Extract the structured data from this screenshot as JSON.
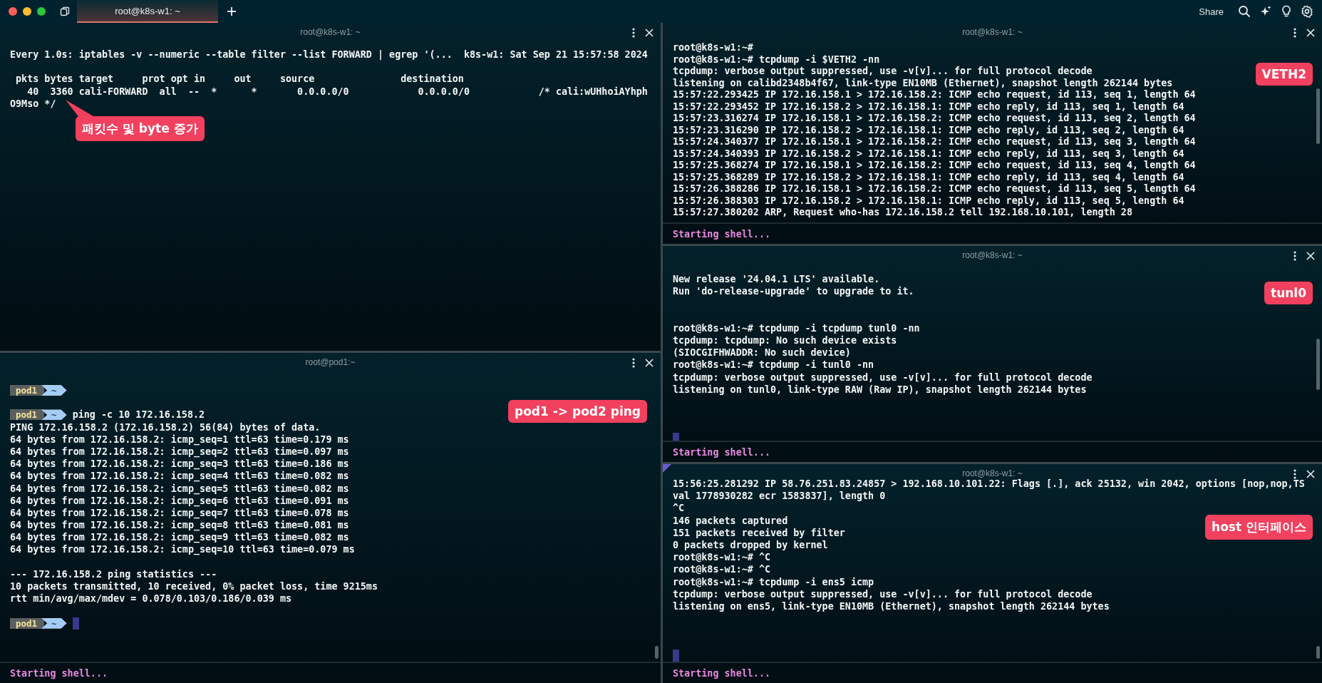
{
  "tab_bar": {
    "tabs": [
      {
        "label": "root@k8s-w1: ~",
        "selected": true
      }
    ],
    "share": "Share"
  },
  "left_column": {
    "panes": [
      {
        "title": "root@k8s-w1: ~",
        "annotation": {
          "text": "패킷수 및 byte 증가",
          "pointer": true
        },
        "lines": [
          {
            "kind": "text",
            "text": "Every 1.0s: iptables -v --numeric --table filter --list FORWARD | egrep '(...  k8s-w1: Sat Sep 21 15:57:58 2024"
          },
          {
            "kind": "blank"
          },
          {
            "kind": "text",
            "text": " pkts bytes target     prot opt in     out     source               destination"
          },
          {
            "kind": "text",
            "text": "   40  3360 cali-FORWARD  all  --  *      *       0.0.0.0/0            0.0.0.0/0            /* cali:wUHhoiAYhph"
          },
          {
            "kind": "text",
            "text": "O9Mso */"
          }
        ]
      },
      {
        "title": "root@pod1:~",
        "annotation": {
          "text": "pod1 -> pod2 ping",
          "pointer": false
        },
        "status": "Starting shell...",
        "lines": [
          {
            "kind": "prompt",
            "segments": [
              "pod1",
              "~"
            ],
            "cursor": false
          },
          {
            "kind": "blank"
          },
          {
            "kind": "prompt",
            "segments": [
              "pod1",
              "~"
            ],
            "command": "ping -c 10 172.16.158.2",
            "cursor": false
          },
          {
            "kind": "text",
            "text": "PING 172.16.158.2 (172.16.158.2) 56(84) bytes of data."
          },
          {
            "kind": "text",
            "text": "64 bytes from 172.16.158.2: icmp_seq=1 ttl=63 time=0.179 ms"
          },
          {
            "kind": "text",
            "text": "64 bytes from 172.16.158.2: icmp_seq=2 ttl=63 time=0.097 ms"
          },
          {
            "kind": "text",
            "text": "64 bytes from 172.16.158.2: icmp_seq=3 ttl=63 time=0.186 ms"
          },
          {
            "kind": "text",
            "text": "64 bytes from 172.16.158.2: icmp_seq=4 ttl=63 time=0.082 ms"
          },
          {
            "kind": "text",
            "text": "64 bytes from 172.16.158.2: icmp_seq=5 ttl=63 time=0.082 ms"
          },
          {
            "kind": "text",
            "text": "64 bytes from 172.16.158.2: icmp_seq=6 ttl=63 time=0.091 ms"
          },
          {
            "kind": "text",
            "text": "64 bytes from 172.16.158.2: icmp_seq=7 ttl=63 time=0.078 ms"
          },
          {
            "kind": "text",
            "text": "64 bytes from 172.16.158.2: icmp_seq=8 ttl=63 time=0.081 ms"
          },
          {
            "kind": "text",
            "text": "64 bytes from 172.16.158.2: icmp_seq=9 ttl=63 time=0.082 ms"
          },
          {
            "kind": "text",
            "text": "64 bytes from 172.16.158.2: icmp_seq=10 ttl=63 time=0.079 ms"
          },
          {
            "kind": "blank"
          },
          {
            "kind": "text",
            "text": "--- 172.16.158.2 ping statistics ---"
          },
          {
            "kind": "text",
            "text": "10 packets transmitted, 10 received, 0% packet loss, time 9215ms"
          },
          {
            "kind": "text",
            "text": "rtt min/avg/max/mdev = 0.078/0.103/0.186/0.039 ms"
          },
          {
            "kind": "blank"
          },
          {
            "kind": "prompt",
            "segments": [
              "pod1",
              "~"
            ],
            "cursor": true
          }
        ]
      }
    ]
  },
  "right_column": {
    "panes": [
      {
        "title": "root@k8s-w1: ~",
        "annotation": {
          "text": "VETH2",
          "pointer": false
        },
        "status": "Starting shell...",
        "lines": [
          {
            "kind": "text",
            "text": "root@k8s-w1:~#"
          },
          {
            "kind": "text",
            "text": "root@k8s-w1:~# tcpdump -i $VETH2 -nn"
          },
          {
            "kind": "text",
            "text": "tcpdump: verbose output suppressed, use -v[v]... for full protocol decode"
          },
          {
            "kind": "text",
            "text": "listening on calibd2348b4f67, link-type EN10MB (Ethernet), snapshot length 262144 bytes"
          },
          {
            "kind": "text",
            "text": "15:57:22.293425 IP 172.16.158.1 > 172.16.158.2: ICMP echo request, id 113, seq 1, length 64"
          },
          {
            "kind": "text",
            "text": "15:57:22.293452 IP 172.16.158.2 > 172.16.158.1: ICMP echo reply, id 113, seq 1, length 64"
          },
          {
            "kind": "text",
            "text": "15:57:23.316274 IP 172.16.158.1 > 172.16.158.2: ICMP echo request, id 113, seq 2, length 64"
          },
          {
            "kind": "text",
            "text": "15:57:23.316290 IP 172.16.158.2 > 172.16.158.1: ICMP echo reply, id 113, seq 2, length 64"
          },
          {
            "kind": "text",
            "text": "15:57:24.340377 IP 172.16.158.1 > 172.16.158.2: ICMP echo request, id 113, seq 3, length 64"
          },
          {
            "kind": "text",
            "text": "15:57:24.340393 IP 172.16.158.2 > 172.16.158.1: ICMP echo reply, id 113, seq 3, length 64"
          },
          {
            "kind": "text",
            "text": "15:57:25.368274 IP 172.16.158.1 > 172.16.158.2: ICMP echo request, id 113, seq 4, length 64"
          },
          {
            "kind": "text",
            "text": "15:57:25.368289 IP 172.16.158.2 > 172.16.158.1: ICMP echo reply, id 113, seq 4, length 64"
          },
          {
            "kind": "text",
            "text": "15:57:26.388286 IP 172.16.158.1 > 172.16.158.2: ICMP echo request, id 113, seq 5, length 64"
          },
          {
            "kind": "text",
            "text": "15:57:26.388303 IP 172.16.158.2 > 172.16.158.1: ICMP echo reply, id 113, seq 5, length 64"
          },
          {
            "kind": "text",
            "text": "15:57:27.380202 ARP, Request who-has 172.16.158.2 tell 192.168.10.101, length 28"
          }
        ]
      },
      {
        "title": "root@k8s-w1: ~",
        "annotation": {
          "text": "tunl0",
          "pointer": false
        },
        "status": "Starting shell...",
        "lines": [
          {
            "kind": "text",
            "text": "New release '24.04.1 LTS' available."
          },
          {
            "kind": "text",
            "text": "Run 'do-release-upgrade' to upgrade to it."
          },
          {
            "kind": "blank"
          },
          {
            "kind": "blank"
          },
          {
            "kind": "text",
            "text": "root@k8s-w1:~# tcpdump -i tcpdump tunl0 -nn"
          },
          {
            "kind": "text",
            "text": "tcpdump: tcpdump: No such device exists"
          },
          {
            "kind": "text",
            "text": "(SIOCGIFHWADDR: No such device)"
          },
          {
            "kind": "text",
            "text": "root@k8s-w1:~# tcpdump -i tunl0 -nn"
          },
          {
            "kind": "text",
            "text": "tcpdump: verbose output suppressed, use -v[v]... for full protocol decode"
          },
          {
            "kind": "text",
            "text": "listening on tunl0, link-type RAW (Raw IP), snapshot length 262144 bytes"
          },
          {
            "kind": "blank"
          },
          {
            "kind": "blank"
          },
          {
            "kind": "blank"
          },
          {
            "kind": "cursor"
          }
        ]
      },
      {
        "title": "root@k8s-w1: ~",
        "annotation": {
          "text": "host 인터페이스",
          "pointer": false
        },
        "status": "Starting shell...",
        "lines": [
          {
            "kind": "text",
            "text": "15:56:25.281292 IP 58.76.251.83.24857 > 192.168.10.101.22: Flags [.], ack 25132, win 2042, options [nop,nop,TS"
          },
          {
            "kind": "text",
            "text": "val 1778930282 ecr 1583837], length 0"
          },
          {
            "kind": "text",
            "text": "^C"
          },
          {
            "kind": "text",
            "text": "146 packets captured"
          },
          {
            "kind": "text",
            "text": "151 packets received by filter"
          },
          {
            "kind": "text",
            "text": "0 packets dropped by kernel"
          },
          {
            "kind": "text",
            "text": "root@k8s-w1:~# ^C"
          },
          {
            "kind": "text",
            "text": "root@k8s-w1:~# ^C"
          },
          {
            "kind": "text",
            "text": "root@k8s-w1:~# tcpdump -i ens5 icmp"
          },
          {
            "kind": "text",
            "text": "tcpdump: verbose output suppressed, use -v[v]... for full protocol decode"
          },
          {
            "kind": "text",
            "text": "listening on ens5, link-type EN10MB (Ethernet), snapshot length 262144 bytes"
          },
          {
            "kind": "blank"
          },
          {
            "kind": "blank"
          },
          {
            "kind": "blank"
          },
          {
            "kind": "cursor"
          }
        ]
      }
    ]
  }
}
